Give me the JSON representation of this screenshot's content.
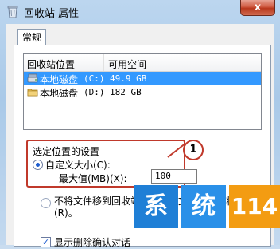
{
  "window": {
    "title": "回收站 属性",
    "close_label": "x"
  },
  "tabs": [
    {
      "label": "常规"
    }
  ],
  "list": {
    "headers": [
      "回收站位置",
      "可用空间"
    ],
    "rows": [
      {
        "name": "本地磁盘",
        "letter": "(C:)",
        "space": "49.9 GB",
        "selected": true
      },
      {
        "name": "本地磁盘",
        "letter": "(D:)",
        "space": "182 GB",
        "selected": false
      }
    ]
  },
  "settings": {
    "group_title": "选定位置的设置",
    "custom_size_label": "自定义大小(C):",
    "max_label": "最大值(MB)(X):",
    "max_value": "100",
    "no_move_label": "不将文件移到回收站中。移除文件后立即将其删除(R)。",
    "confirm_label": "显示删除确认对话"
  },
  "callout": {
    "number": "1"
  },
  "watermark": {
    "chars": [
      "系",
      "统",
      "114"
    ]
  },
  "colors": {
    "highlight": "#c0392b",
    "selection": "#3399ff"
  },
  "icons": [
    "recycle-bin-icon",
    "drive-icon",
    "folder-drive-icon"
  ]
}
